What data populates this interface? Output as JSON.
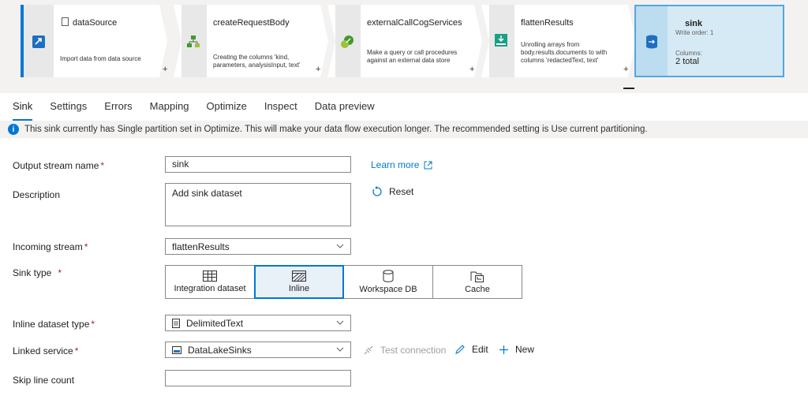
{
  "pipeline": {
    "nodes": [
      {
        "title": "dataSource",
        "desc": "Import data from data source"
      },
      {
        "title": "createRequestBody",
        "desc": "Creating the columns 'kind, parameters, analysisInput, text'"
      },
      {
        "title": "externalCallCogServices",
        "desc": "Make a query or call procedures against an external data store"
      },
      {
        "title": "flattenResults",
        "desc": "Unrolling arrays from body.results.documents to with columns 'redactedText, text'"
      }
    ],
    "sink": {
      "title": "sink",
      "write_order": "Write order: 1",
      "columns_label": "Columns:",
      "columns_total": "2 total"
    },
    "plus": "+"
  },
  "tabs": [
    {
      "label": "Sink",
      "active": true
    },
    {
      "label": "Settings"
    },
    {
      "label": "Errors"
    },
    {
      "label": "Mapping"
    },
    {
      "label": "Optimize"
    },
    {
      "label": "Inspect"
    },
    {
      "label": "Data preview"
    }
  ],
  "info": {
    "icon": "info-icon",
    "text": "This sink currently has Single partition set in Optimize. This will make your data flow execution longer. The recommended setting is Use current partitioning."
  },
  "form": {
    "output_stream": {
      "label": "Output stream name",
      "value": "sink"
    },
    "learn_more": "Learn more",
    "description": {
      "label": "Description",
      "value": "Add sink dataset"
    },
    "reset": "Reset",
    "incoming": {
      "label": "Incoming stream",
      "value": "flattenResults"
    },
    "sink_type": {
      "label": "Sink type",
      "options": [
        {
          "label": "Integration dataset"
        },
        {
          "label": "Inline"
        },
        {
          "label": "Workspace DB"
        },
        {
          "label": "Cache"
        }
      ],
      "selected": "Inline"
    },
    "inline_type": {
      "label": "Inline dataset type",
      "value": "DelimitedText"
    },
    "linked_service": {
      "label": "Linked service",
      "value": "DataLakeSinks"
    },
    "test_connection": "Test connection",
    "edit": "Edit",
    "new": "New",
    "skip_lines": {
      "label": "Skip line count",
      "value": ""
    },
    "required_mark": "*"
  },
  "colors": {
    "accent": "#0078d4",
    "required": "#a4262c",
    "sink_selected_bg": "#d6eaf5"
  }
}
